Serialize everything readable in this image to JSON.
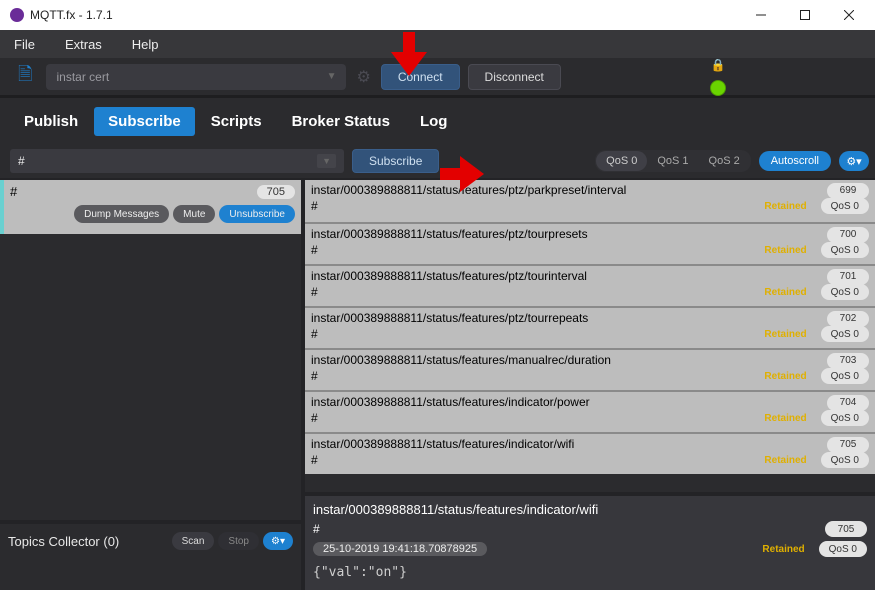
{
  "window": {
    "title": "MQTT.fx - 1.7.1"
  },
  "menubar": {
    "file": "File",
    "extras": "Extras",
    "help": "Help"
  },
  "connection": {
    "profile": "instar cert",
    "connect": "Connect",
    "disconnect": "Disconnect"
  },
  "tabs": {
    "publish": "Publish",
    "subscribe": "Subscribe",
    "scripts": "Scripts",
    "broker": "Broker Status",
    "log": "Log"
  },
  "subtoolbar": {
    "topic": "#",
    "subscribe": "Subscribe",
    "qos0": "QoS 0",
    "qos1": "QoS 1",
    "qos2": "QoS 2",
    "autoscroll": "Autoscroll"
  },
  "subscription": {
    "topic": "#",
    "count": "705",
    "dump": "Dump Messages",
    "mute": "Mute",
    "unsubscribe": "Unsubscribe"
  },
  "collector": {
    "label": "Topics Collector (0)",
    "scan": "Scan",
    "stop": "Stop"
  },
  "messages": [
    {
      "topic": "instar/000389888811/status/features/ptz/parkpreset/interval",
      "hash": "#",
      "num": "699",
      "retained": "Retained",
      "qos": "QoS 0"
    },
    {
      "topic": "instar/000389888811/status/features/ptz/tourpresets",
      "hash": "#",
      "num": "700",
      "retained": "Retained",
      "qos": "QoS 0"
    },
    {
      "topic": "instar/000389888811/status/features/ptz/tourinterval",
      "hash": "#",
      "num": "701",
      "retained": "Retained",
      "qos": "QoS 0"
    },
    {
      "topic": "instar/000389888811/status/features/ptz/tourrepeats",
      "hash": "#",
      "num": "702",
      "retained": "Retained",
      "qos": "QoS 0"
    },
    {
      "topic": "instar/000389888811/status/features/manualrec/duration",
      "hash": "#",
      "num": "703",
      "retained": "Retained",
      "qos": "QoS 0"
    },
    {
      "topic": "instar/000389888811/status/features/indicator/power",
      "hash": "#",
      "num": "704",
      "retained": "Retained",
      "qos": "QoS 0"
    },
    {
      "topic": "instar/000389888811/status/features/indicator/wifi",
      "hash": "#",
      "num": "705",
      "retained": "Retained",
      "qos": "QoS 0"
    }
  ],
  "detail": {
    "topic": "instar/000389888811/status/features/indicator/wifi",
    "hash": "#",
    "num": "705",
    "timestamp": "25-10-2019 19:41:18.70878925",
    "retained": "Retained",
    "qos": "QoS 0",
    "payload": "{\"val\":\"on\"}"
  }
}
